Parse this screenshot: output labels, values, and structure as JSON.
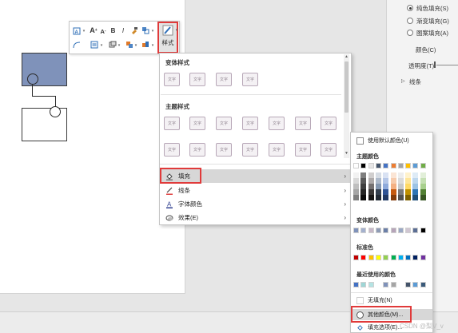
{
  "right_pane": {
    "fill_options": [
      {
        "label": "纯色填充(S)",
        "selected": true
      },
      {
        "label": "渐变填充(G)",
        "selected": false
      },
      {
        "label": "图案填充(A)",
        "selected": false
      }
    ],
    "color_label": "颜色(C)",
    "transparency_label": "透明度(T)",
    "line_section": "线条"
  },
  "mini_toolbar": {
    "font_grow": "A",
    "font_shrink": "A",
    "bold": "B",
    "italic": "I",
    "style_button_label": "样式"
  },
  "style_menu": {
    "variant_heading": "变体样式",
    "theme_heading": "主题样式",
    "sample_text": "文字",
    "items": [
      {
        "label": "填充",
        "icon": "paint-bucket-icon"
      },
      {
        "label": "线条",
        "icon": "pen-line-icon"
      },
      {
        "label": "字体颜色",
        "icon": "font-color-icon"
      },
      {
        "label": "效果(E)",
        "icon": "effects-icon"
      }
    ]
  },
  "color_menu": {
    "default_color": "使用默认颜色(U)",
    "theme_colors": "主题颜色",
    "variant_colors": "变体颜色",
    "standard_colors": "标准色",
    "recent_colors": "最近使用的颜色",
    "no_fill": "无填充(N)",
    "more_colors": "其他颜色(M)...",
    "fill_options": "填充选项(E)...",
    "theme_row": [
      "#ffffff",
      "#000000",
      "#e7e6e6",
      "#44546a",
      "#4472c4",
      "#ed7d31",
      "#a5a5a5",
      "#ffc000",
      "#5b9bd5",
      "#70ad47"
    ],
    "theme_columns": [
      [
        "#f2f2f2",
        "#d9d9d9",
        "#bfbfbf",
        "#a6a6a6",
        "#7f7f7f"
      ],
      [
        "#7f7f7f",
        "#595959",
        "#3f3f3f",
        "#262626",
        "#0d0d0d"
      ],
      [
        "#d0cece",
        "#aeaaaa",
        "#757171",
        "#3a3838",
        "#171616"
      ],
      [
        "#d6dce4",
        "#adb9ca",
        "#8497b0",
        "#333f4f",
        "#222a35"
      ],
      [
        "#d9e2f3",
        "#b4c6e7",
        "#8eaadb",
        "#2f5496",
        "#1f3864"
      ],
      [
        "#fbe5d5",
        "#f7cbac",
        "#f4b083",
        "#c55a11",
        "#833c0b"
      ],
      [
        "#ededed",
        "#dbdbdb",
        "#c9c9c9",
        "#7b7b7b",
        "#525252"
      ],
      [
        "#fff2cc",
        "#fee599",
        "#ffd965",
        "#bf9000",
        "#7f6000"
      ],
      [
        "#deebf6",
        "#bdd7ee",
        "#9cc3e5",
        "#2e75b5",
        "#1e4e79"
      ],
      [
        "#e2efd9",
        "#c5e0b3",
        "#a8d08d",
        "#538135",
        "#375623"
      ]
    ],
    "variant_row": [
      "#7f92ba",
      "#a4b1ce",
      "#c7b8c8",
      "#8e9bb5",
      "#6b7fa8",
      "#b6a4b9",
      "#9aa8c4",
      "#d0c6d2",
      "#5b6e94",
      "#000000"
    ],
    "standard_row": [
      "#c00000",
      "#ff0000",
      "#ffc000",
      "#ffff00",
      "#92d050",
      "#00b050",
      "#00b0f0",
      "#0070c0",
      "#002060",
      "#7030a0"
    ],
    "recent_row": [
      "#4472c4",
      "#9fd6d6",
      "#b4e3e3",
      "",
      "#7f92ba",
      "#a5a5a5",
      "",
      "#44546a",
      "#5b9bd5",
      "#3a5a7a"
    ]
  },
  "watermark": "CSDN @梨V_v"
}
